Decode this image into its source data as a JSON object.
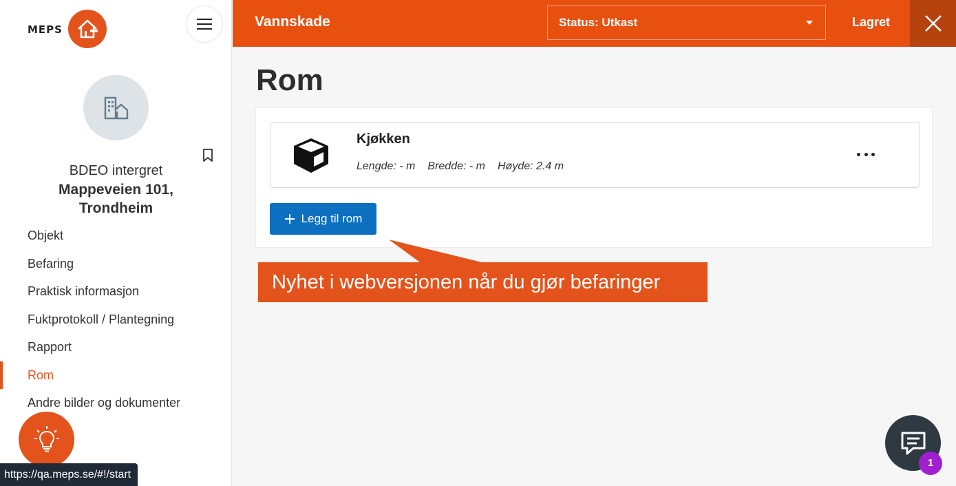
{
  "app": {
    "logo_text": "MEPS"
  },
  "property": {
    "subtitle": "BDEO intergret",
    "title_line1": "Mappeveien 101,",
    "title_line2": "Trondheim"
  },
  "sidebar": {
    "items": [
      {
        "label": "Objekt",
        "active": false
      },
      {
        "label": "Befaring",
        "active": false
      },
      {
        "label": "Praktisk informasjon",
        "active": false
      },
      {
        "label": "Fuktprotokoll / Plantegning",
        "active": false
      },
      {
        "label": "Rapport",
        "active": false
      },
      {
        "label": "Rom",
        "active": true
      },
      {
        "label": "Andre bilder og dokumenter",
        "active": false
      }
    ]
  },
  "topbar": {
    "title": "Vannskade",
    "status": "Status: Utkast",
    "saved_label": "Lagret"
  },
  "main": {
    "page_title": "Rom",
    "rooms": [
      {
        "name": "Kjøkken",
        "length": "Lengde: - m",
        "width": "Bredde: - m",
        "height": "Høyde: 2.4 m"
      }
    ],
    "add_button_label": "Legg til rom"
  },
  "callout": {
    "text": "Nyhet i webversjonen når du gjør befaringer"
  },
  "status_url": "https://qa.meps.se/#!/start",
  "chat": {
    "badge_count": "1"
  },
  "colors": {
    "accent": "#e85010",
    "primary_button": "#0d6fc0",
    "badge": "#a21fd0"
  },
  "icons": [
    "house-logo-icon",
    "hamburger-icon",
    "building-icon",
    "bookmark-icon",
    "lightbulb-icon",
    "caret-down-icon",
    "close-icon",
    "cube-icon",
    "more-icon",
    "plus-icon",
    "chat-icon"
  ]
}
